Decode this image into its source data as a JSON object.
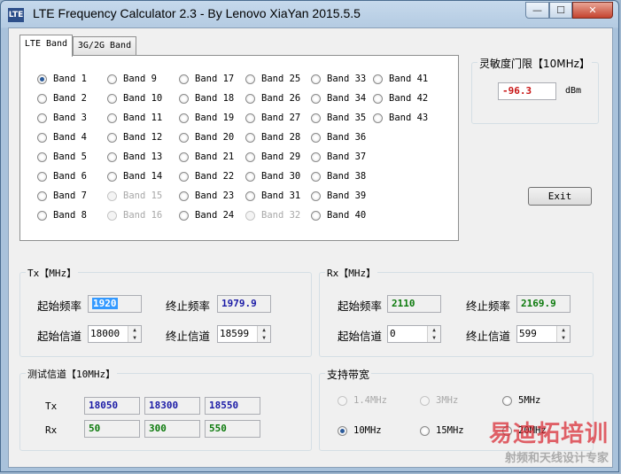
{
  "window": {
    "title": "LTE Frequency Calculator 2.3 - By Lenovo XiaYan 2015.5.5",
    "icon_text": "LTE",
    "min_icon": "minimize-icon",
    "max_icon": "maximize-icon",
    "close_icon": "close-icon"
  },
  "tabs": [
    {
      "label": "LTE Band"
    },
    {
      "label": "3G/2G Band"
    }
  ],
  "bands": {
    "col1": [
      "Band 1",
      "Band 2",
      "Band 3",
      "Band 4",
      "Band 5",
      "Band 6",
      "Band 7",
      "Band 8"
    ],
    "col2": [
      "Band 9",
      "Band 10",
      "Band 11",
      "Band 12",
      "Band 13",
      "Band 14",
      "Band 15",
      "Band 16"
    ],
    "col3": [
      "Band 17",
      "Band 18",
      "Band 19",
      "Band 20",
      "Band 21",
      "Band 22",
      "Band 23",
      "Band 24"
    ],
    "col4": [
      "Band 25",
      "Band 26",
      "Band 27",
      "Band 28",
      "Band 29",
      "Band 30",
      "Band 31",
      "Band 32"
    ],
    "col5": [
      "Band 33",
      "Band 34",
      "Band 35",
      "Band 36",
      "Band 37",
      "Band 38",
      "Band 39",
      "Band 40"
    ],
    "col6": [
      "Band 41",
      "Band 42",
      "Band 43"
    ],
    "selected": "Band 1",
    "disabled": [
      "Band 15",
      "Band 16",
      "Band 32"
    ]
  },
  "sensitivity": {
    "title": "灵敏度门限【10MHz】",
    "value": "-96.3",
    "unit": "dBm"
  },
  "exit_label": "Exit",
  "tx": {
    "title": "Tx【MHz】",
    "start_freq_label": "起始频率",
    "start_freq": "1920",
    "end_freq_label": "终止频率",
    "end_freq": "1979.9",
    "start_ch_label": "起始信道",
    "start_ch": "18000",
    "end_ch_label": "终止信道",
    "end_ch": "18599"
  },
  "rx": {
    "title": "Rx【MHz】",
    "start_freq_label": "起始频率",
    "start_freq": "2110",
    "end_freq_label": "终止频率",
    "end_freq": "2169.9",
    "start_ch_label": "起始信道",
    "start_ch": "0",
    "end_ch_label": "终止信道",
    "end_ch": "599"
  },
  "test": {
    "title": "测试信道【10MHz】",
    "tx_label": "Tx",
    "rx_label": "Rx",
    "tx_values": [
      "18050",
      "18300",
      "18550"
    ],
    "rx_values": [
      "50",
      "300",
      "550"
    ]
  },
  "bandwidth": {
    "title": "支持带宽",
    "options": [
      "1.4MHz",
      "3MHz",
      "5MHz",
      "10MHz",
      "15MHz",
      "20MHz"
    ],
    "selected": "10MHz",
    "disabled": [
      "1.4MHz",
      "3MHz"
    ]
  },
  "watermark": {
    "line1": "易迪拓培训",
    "line2": "射频和天线设计专家"
  },
  "colors": {
    "tx_value": "#1a1aa6",
    "rx_value": "#0c7a0c",
    "sensitivity": "#c81414"
  }
}
